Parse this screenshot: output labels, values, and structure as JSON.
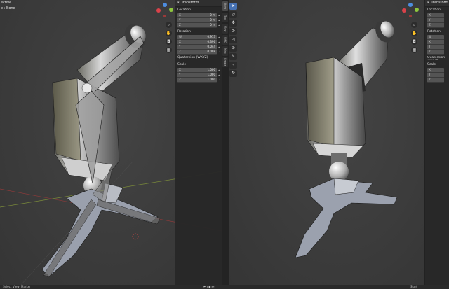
{
  "left_viewport": {
    "header_line1": "ective",
    "header_line2": "e : Bone"
  },
  "n_panel": {
    "title": "Transform",
    "location": {
      "label": "Location",
      "fields": [
        {
          "axis": "X",
          "value": "0 m"
        },
        {
          "axis": "Y",
          "value": "0 m"
        },
        {
          "axis": "Z",
          "value": "0 m"
        }
      ]
    },
    "rotation": {
      "label": "Rotation",
      "fields": [
        {
          "axis": "W",
          "value": "0.913"
        },
        {
          "axis": "X",
          "value": "0.396"
        },
        {
          "axis": "Y",
          "value": "0.044"
        },
        {
          "axis": "Z",
          "value": "0.098"
        }
      ],
      "mode": "Quaternion (WXYZ)"
    },
    "scale": {
      "label": "Scale",
      "fields": [
        {
          "axis": "X",
          "value": "1.000"
        },
        {
          "axis": "Y",
          "value": "1.000"
        },
        {
          "axis": "Z",
          "value": "1.000"
        }
      ]
    }
  },
  "n_panel_right": {
    "title": "Transform",
    "location_label": "Location",
    "rotation_label": "Rotation",
    "scale_label": "Scale",
    "location_axes": [
      "X",
      "Y",
      "Z"
    ],
    "rotation_axes": [
      "W",
      "X",
      "Y",
      "Z"
    ],
    "rotation_mode": "Quaternion (WXYZ)",
    "scale_axes": [
      "X",
      "Y",
      "Z"
    ]
  },
  "side_tabs": [
    "Item",
    "Tool",
    "View",
    "SMID",
    "Misc",
    "Create"
  ],
  "statusbar": {
    "select": "Select",
    "view": "View",
    "marker": "Marker",
    "right_text": "Start"
  },
  "colors": {
    "x_axis": "#d9424a",
    "y_axis": "#8ec73e",
    "z_axis": "#4d8de0",
    "active_tool": "#4772b3"
  },
  "icons": {
    "zoom": "magnifier-icon",
    "pan": "hand-icon",
    "camera": "camera-icon",
    "grid": "grid-icon"
  }
}
